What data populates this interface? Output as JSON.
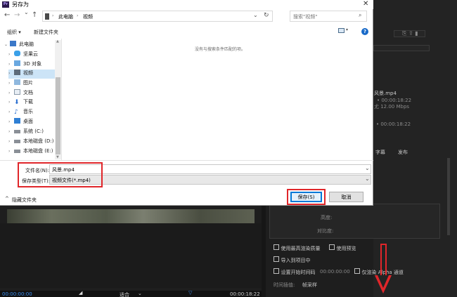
{
  "dialog": {
    "title": "另存为",
    "app_icon_text": "Pr",
    "close_glyph": "✕"
  },
  "nav": {
    "back_glyph": "←",
    "forward_glyph": "→",
    "dropdown_glyph": "⌄",
    "up_glyph": "↑",
    "breadcrumb": [
      "此电脑",
      "视频"
    ],
    "refresh_glyph": "↻",
    "search_placeholder": "搜索\"视频\""
  },
  "toolbar": {
    "organize": "组织 ▾",
    "new_folder": "新建文件夹",
    "help": "?"
  },
  "sidebar": {
    "items": [
      {
        "label": "此电脑",
        "icon": "computer-icon",
        "expanded": true,
        "selected": false
      },
      {
        "label": "坚果云",
        "icon": "nutstore-icon",
        "expanded": false,
        "selected": false
      },
      {
        "label": "3D 对象",
        "icon": "3d-objects-icon",
        "expanded": false,
        "selected": false
      },
      {
        "label": "视频",
        "icon": "video-folder-icon",
        "expanded": false,
        "selected": true
      },
      {
        "label": "图片",
        "icon": "pictures-icon",
        "expanded": false,
        "selected": false
      },
      {
        "label": "文档",
        "icon": "documents-icon",
        "expanded": false,
        "selected": false
      },
      {
        "label": "下载",
        "icon": "downloads-icon",
        "expanded": false,
        "selected": false
      },
      {
        "label": "音乐",
        "icon": "music-icon",
        "expanded": false,
        "selected": false
      },
      {
        "label": "桌面",
        "icon": "desktop-icon",
        "expanded": false,
        "selected": false
      },
      {
        "label": "系统 (C:)",
        "icon": "drive-c-icon",
        "expanded": false,
        "selected": false
      },
      {
        "label": "本地磁盘 (D:)",
        "icon": "drive-icon",
        "expanded": false,
        "selected": false
      },
      {
        "label": "本地磁盘 (E:)",
        "icon": "drive-icon",
        "expanded": false,
        "selected": false
      }
    ]
  },
  "main": {
    "empty_message": "没有与搜索条件匹配的项。"
  },
  "form": {
    "filename_label": "文件名(N):",
    "filename_value": "风景.mp4",
    "filetype_label": "保存类型(T):",
    "filetype_value": "视频文件(*.mp4)"
  },
  "footer": {
    "hide_folders": "隐藏文件夹",
    "save": "保存(S)",
    "cancel": "取消"
  },
  "background": {
    "info_lines": [
      "风景.mp4",
      "• 00:00:18:22",
      "尤 12.00 Mbps"
    ],
    "info_time2": "• 00:00:18:22",
    "tabs": [
      "字幕",
      "发布"
    ],
    "height_label": "高度:",
    "ratio_label": "对比度:",
    "opt_max_quality": "使用最高渲染质量",
    "opt_preview": "使用预览",
    "opt_import": "导入到项目中",
    "opt_start_timecode": "设置开始时间码",
    "start_timecode_value": "00:00:00:00",
    "opt_alpha": "仅渲染 Alpha 通道",
    "interp_label": "时间插值:",
    "interp_value": "帧采样",
    "timecode_left": "00:00:00:00",
    "fit_label": "适合",
    "timecode_right": "00:00:18:22"
  },
  "colors": {
    "highlight_red": "#e0262a",
    "selection_blue": "#cce4f7",
    "accent_blue": "#0078d7"
  }
}
